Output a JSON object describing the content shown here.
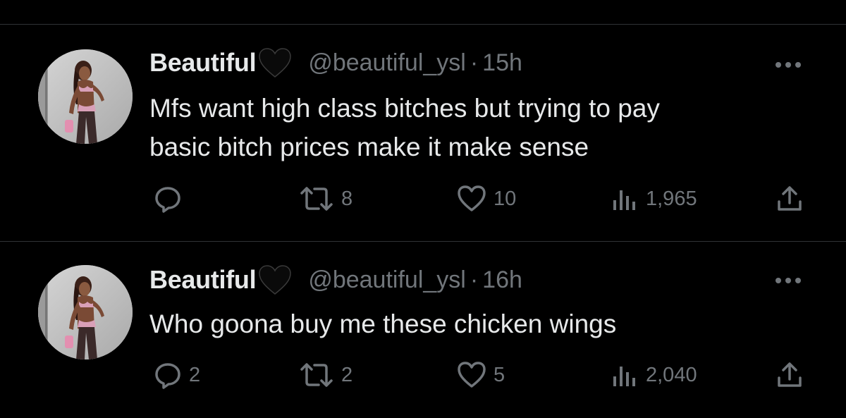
{
  "tweets": [
    {
      "name": "Beautiful",
      "handle": "@beautiful_ysl",
      "separator": "·",
      "time": "15h",
      "text_lines": [
        "Mfs want high class bitches but trying to pay",
        "basic bitch prices make it make sense"
      ],
      "replies": "",
      "retweets": "8",
      "likes": "10",
      "views": "1,965"
    },
    {
      "name": "Beautiful",
      "handle": "@beautiful_ysl",
      "separator": "·",
      "time": "16h",
      "text_lines": [
        "Who goona buy me these chicken wings"
      ],
      "replies": "2",
      "retweets": "2",
      "likes": "5",
      "views": "2,040"
    }
  ],
  "icons": {
    "name_badge": "black-heart-icon",
    "more": "more-options-icon",
    "reply": "reply-icon",
    "retweet": "retweet-icon",
    "like": "like-icon",
    "views": "views-icon",
    "share": "share-icon"
  },
  "colors": {
    "background": "#000000",
    "primary_text": "#e7e9ea",
    "secondary_text": "#71767b",
    "divider": "#2f3336"
  }
}
